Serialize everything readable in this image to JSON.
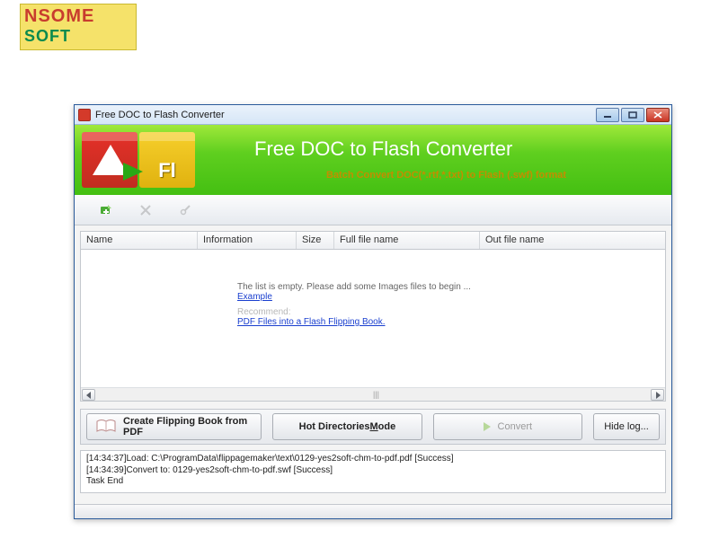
{
  "page_logo": {
    "line1": "NSOME",
    "line2": "SOFT"
  },
  "window": {
    "title": "Free DOC to Flash Converter",
    "banner_title": "Free DOC to Flash Converter",
    "banner_sub": "Batch Convert  DOC(*.rtf,*.txt) to Flash (.swf) format"
  },
  "toolbar": {
    "add_tooltip": "Add file",
    "remove_tooltip": "Remove",
    "settings_tooltip": "Settings"
  },
  "columns": {
    "name": "Name",
    "info": "Information",
    "size": "Size",
    "full": "Full file name",
    "out": "Out file name"
  },
  "list_empty": {
    "message": "The list is empty. Please add some Images files to begin ...",
    "example_link": "Example",
    "recommend_label": "Recommend:",
    "recommend_link": "PDF Files into a Flash Flipping Book."
  },
  "buttons": {
    "create_flip": "Create Flipping Book  from PDF",
    "hot_dirs_prefix": "Hot Directories ",
    "hot_dirs_ul": "M",
    "hot_dirs_suffix": "ode",
    "convert": "Convert",
    "hide_log": "Hide log..."
  },
  "log": {
    "lines": [
      "[14:34:37]Load: C:\\ProgramData\\flippagemaker\\text\\0129-yes2soft-chm-to-pdf.pdf [Success]",
      "[14:34:39]Convert to: 0129-yes2soft-chm-to-pdf.swf [Success]",
      "Task End"
    ]
  }
}
